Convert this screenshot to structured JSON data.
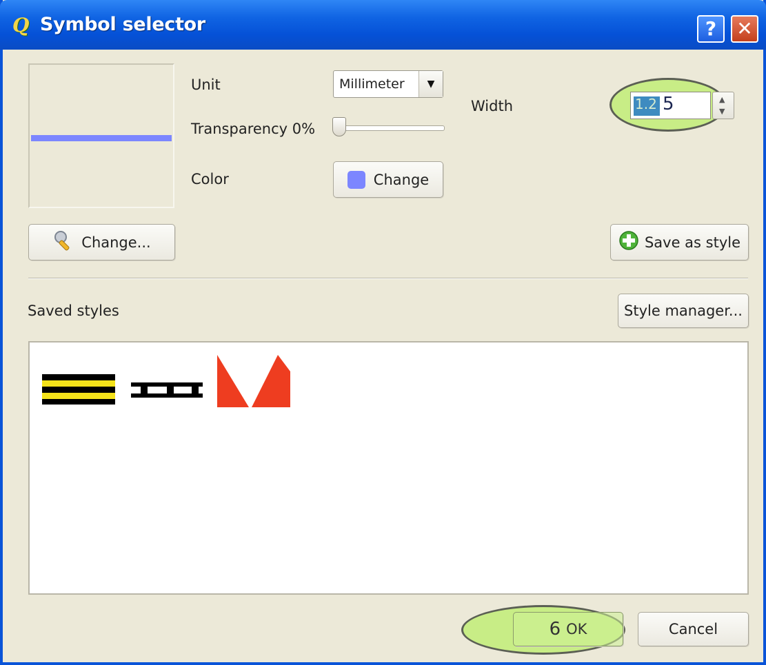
{
  "window": {
    "title": "Symbol selector",
    "help_label": "?",
    "close_label": "✕",
    "logo_glyph": "Q"
  },
  "symbol": {
    "line_color": "#7c86ff"
  },
  "properties": {
    "unit_label": "Unit",
    "unit_value": "Millimeter",
    "transparency_label": "Transparency 0%",
    "transparency_value": 0,
    "color_label": "Color",
    "color_button_label": "Change",
    "width_label": "Width",
    "width_value": "1.2",
    "width_typed": "5"
  },
  "buttons": {
    "change_symbol_label": "Change...",
    "save_style_label": "Save as style",
    "style_manager_label": "Style manager...",
    "ok_label": "OK",
    "ok_step": "6",
    "cancel_label": "Cancel"
  },
  "saved_styles": {
    "label": "Saved styles",
    "items": [
      "yellow-black-road-line",
      "black-rail-line",
      "red-triangle-line"
    ]
  },
  "colors": {
    "titlebar": "#0a54d8",
    "dialog_bg": "#ece9d8",
    "highlight": "#bef06e",
    "accent_red": "#ee3d20",
    "accent_yellow": "#f4e21a"
  }
}
